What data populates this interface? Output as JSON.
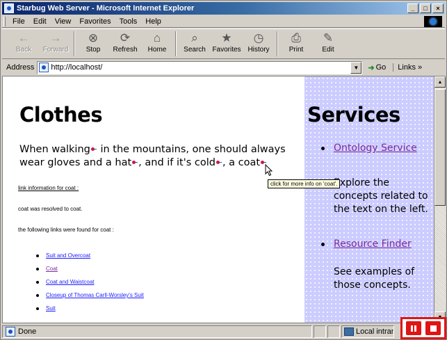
{
  "window": {
    "title": "Starbug Web Server - Microsoft Internet Explorer",
    "controls": [
      "_",
      "□",
      "×"
    ]
  },
  "menubar": {
    "items": [
      "File",
      "Edit",
      "View",
      "Favorites",
      "Tools",
      "Help"
    ]
  },
  "toolbar": {
    "buttons": [
      {
        "label": "Back",
        "icon": "back-arrow-icon",
        "glyph": "←",
        "enabled": false
      },
      {
        "label": "Forward",
        "icon": "forward-arrow-icon",
        "glyph": "→",
        "enabled": false
      },
      {
        "label": "Stop",
        "icon": "stop-icon",
        "glyph": "⊗",
        "enabled": true
      },
      {
        "label": "Refresh",
        "icon": "refresh-icon",
        "glyph": "⟳",
        "enabled": true
      },
      {
        "label": "Home",
        "icon": "home-icon",
        "glyph": "⌂",
        "enabled": true
      },
      {
        "label": "Search",
        "icon": "search-icon",
        "glyph": "⌕",
        "enabled": true
      },
      {
        "label": "Favorites",
        "icon": "favorites-icon",
        "glyph": "★",
        "enabled": true
      },
      {
        "label": "History",
        "icon": "history-icon",
        "glyph": "◷",
        "enabled": true
      },
      {
        "label": "Print",
        "icon": "print-icon",
        "glyph": "⎙",
        "enabled": true
      },
      {
        "label": "Edit",
        "icon": "edit-icon",
        "glyph": "✎",
        "enabled": true
      }
    ]
  },
  "addressbar": {
    "label": "Address",
    "url": "http://localhost/",
    "go_label": "Go",
    "links_label": "Links »"
  },
  "page": {
    "title": "Clothes",
    "intro_parts": [
      "When walking",
      " in the mountains, one should always wear gloves and a hat",
      ", and if it's cold",
      ", a coat"
    ],
    "link_info_heading": "link information for coat :",
    "resolved_text": "coat was resolved to coat.",
    "found_text": "the following links were found for coat :",
    "links": [
      "Suit and Overcoat",
      "Coat",
      "Coat and Waistcoat",
      "Closeup of Thomas Carll-Worsley's Suit",
      "Suit"
    ],
    "tooltip": "click for more info on 'coat'."
  },
  "services": {
    "title": "Services",
    "items": [
      {
        "label": "Ontology Service",
        "description": "Explore the concepts related to the text on the left."
      },
      {
        "label": "Resource Finder",
        "description": "See examples of those concepts."
      }
    ]
  },
  "statusbar": {
    "text": "Done",
    "zone": "Local intranet"
  },
  "colors": {
    "services_bg": "#ccccff",
    "marker": "#e0103a",
    "highlight_box": "#e01414"
  }
}
